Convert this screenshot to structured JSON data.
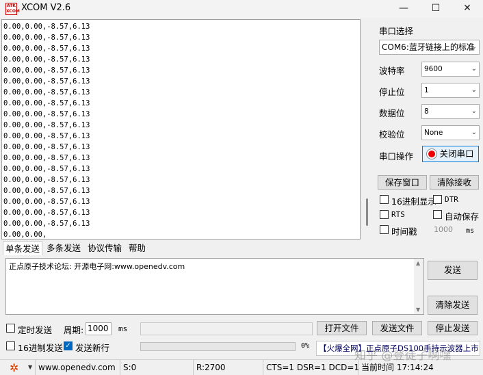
{
  "window": {
    "app_icon_text": "ATK\nXCOM",
    "title": "XCOM V2.6",
    "minimize": "—",
    "maximize": "☐",
    "close": "✕"
  },
  "receive": {
    "lines": [
      "0.00,0.00,-8.57,6.13",
      "0.00,0.00,-8.57,6.13",
      "0.00,0.00,-8.57,6.13",
      "0.00,0.00,-8.57,6.13",
      "0.00,0.00,-8.57,6.13",
      "0.00,0.00,-8.57,6.13",
      "0.00,0.00,-8.57,6.13",
      "0.00,0.00,-8.57,6.13",
      "0.00,0.00,-8.57,6.13",
      "0.00,0.00,-8.57,6.13",
      "0.00,0.00,-8.57,6.13",
      "0.00,0.00,-8.57,6.13",
      "0.00,0.00,-8.57,6.13",
      "0.00,0.00,-8.57,6.13",
      "0.00,0.00,-8.57,6.13",
      "0.00,0.00,-8.57,6.13",
      "0.00,0.00,-8.57,6.13",
      "0.00,0.00,-8.57,6.13",
      "0.00,0.00,-8.57,6.13",
      "0.00,0.00,"
    ]
  },
  "settings": {
    "port_select_label": "串口选择",
    "port_value": "COM6:蓝牙链接上的标准",
    "baud_label": "波特率",
    "baud_value": "9600",
    "stop_label": "停止位",
    "stop_value": "1",
    "data_label": "数据位",
    "data_value": "8",
    "parity_label": "校验位",
    "parity_value": "None",
    "op_label": "串口操作",
    "toggle_label": "关闭串口",
    "save_window": "保存窗口",
    "clear_recv": "清除接收",
    "hex_display": "16进制显示",
    "dtr": "DTR",
    "rts": "RTS",
    "auto_save": "自动保存",
    "timestamp": "时间戳",
    "timestamp_ms": "1000",
    "ms_unit": "ms"
  },
  "tabs": [
    "单条发送",
    "多条发送",
    "协议传输",
    "帮助"
  ],
  "send": {
    "text": "正点原子技术论坛: 开源电子网:www.openedv.com",
    "send_button": "发送",
    "clear_send_button": "清除发送",
    "timed_send": "定时发送",
    "period_label": "周期:",
    "period_value": "1000",
    "period_unit": "ms",
    "open_file": "打开文件",
    "send_file": "发送文件",
    "stop_send": "停止发送",
    "hex_send": "16进制发送",
    "send_newline": "发送新行",
    "progress_text": "0%",
    "progress": 0,
    "ad_text": "【火爆全网】正点原子DS100手持示波器上市"
  },
  "status": {
    "url": "www.openedv.com",
    "sent": "S:0",
    "received": "R:2700",
    "lines": "CTS=1 DSR=1 DCD=1",
    "time": "当前时间 17:14:24"
  },
  "watermark": "知乎 @登徒子啊嘿",
  "colors": {
    "accent": "#0078d7",
    "toggle_dot": "#e00000",
    "gear": "#d23c00"
  }
}
